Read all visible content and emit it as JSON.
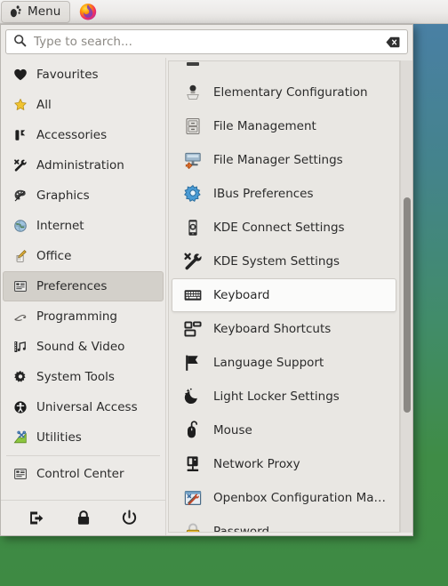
{
  "taskbar": {
    "menu_button_label": "Menu",
    "menu_icon": "footprint-icon",
    "launchers": [
      {
        "name": "firefox-launcher",
        "label": "Firefox"
      }
    ]
  },
  "search": {
    "placeholder": "Type to search...",
    "value": "",
    "icon": "search-icon",
    "clear_icon": "backspace-clear-icon"
  },
  "sidebar": {
    "items": [
      {
        "label": "Favourites",
        "icon": "heart-icon",
        "selected": false
      },
      {
        "label": "All",
        "icon": "star-icon",
        "selected": false
      },
      {
        "label": "Accessories",
        "icon": "accessories-icon",
        "selected": false
      },
      {
        "label": "Administration",
        "icon": "tools-icon",
        "selected": false
      },
      {
        "label": "Graphics",
        "icon": "palette-icon",
        "selected": false
      },
      {
        "label": "Internet",
        "icon": "globe-icon",
        "selected": false
      },
      {
        "label": "Office",
        "icon": "office-icon",
        "selected": false
      },
      {
        "label": "Preferences",
        "icon": "preferences-icon",
        "selected": true
      },
      {
        "label": "Programming",
        "icon": "programming-icon",
        "selected": false
      },
      {
        "label": "Sound & Video",
        "icon": "multimedia-icon",
        "selected": false
      },
      {
        "label": "System Tools",
        "icon": "gear-icon",
        "selected": false
      },
      {
        "label": "Universal Access",
        "icon": "accessibility-icon",
        "selected": false
      },
      {
        "label": "Utilities",
        "icon": "utilities-icon",
        "selected": false
      }
    ],
    "footer_items": [
      {
        "label": "Control Center",
        "icon": "preferences-icon"
      }
    ],
    "session_buttons": [
      {
        "name": "log-out-button",
        "icon": "logout-icon",
        "label": "Log Out"
      },
      {
        "name": "lock-button",
        "icon": "lock-icon",
        "label": "Lock Screen"
      },
      {
        "name": "shutdown-button",
        "icon": "power-icon",
        "label": "Shut Down"
      }
    ]
  },
  "applist": {
    "category": "Preferences",
    "scroll": {
      "thumb_top_pct": 28,
      "thumb_height_pct": 44
    },
    "items": [
      {
        "label": "",
        "icon": "cut-off-icon",
        "hovered": false,
        "partial": true
      },
      {
        "label": "Elementary Configuration",
        "icon": "elementary-config-icon",
        "hovered": false
      },
      {
        "label": "File Management",
        "icon": "file-cabinet-icon",
        "hovered": false
      },
      {
        "label": "File Manager Settings",
        "icon": "file-manager-prefs-icon",
        "hovered": false
      },
      {
        "label": "IBus Preferences",
        "icon": "ibus-gear-icon",
        "hovered": false
      },
      {
        "label": "KDE Connect Settings",
        "icon": "phone-kde-icon",
        "hovered": false
      },
      {
        "label": "KDE System Settings",
        "icon": "tools-icon",
        "hovered": false
      },
      {
        "label": "Keyboard",
        "icon": "keyboard-icon",
        "hovered": true
      },
      {
        "label": "Keyboard Shortcuts",
        "icon": "shortcuts-icon",
        "hovered": false
      },
      {
        "label": "Language Support",
        "icon": "flag-icon",
        "hovered": false
      },
      {
        "label": "Light Locker Settings",
        "icon": "moon-stars-icon",
        "hovered": false
      },
      {
        "label": "Mouse",
        "icon": "mouse-icon",
        "hovered": false
      },
      {
        "label": "Network Proxy",
        "icon": "network-proxy-icon",
        "hovered": false
      },
      {
        "label": "Openbox Configuration Ma…",
        "icon": "openbox-config-icon",
        "hovered": false
      },
      {
        "label": "Password",
        "icon": "padlock-key-icon",
        "hovered": false
      }
    ]
  },
  "colors": {
    "window_bg": "#eceae7",
    "list_bg": "#e9e7e3",
    "selection_bg": "#d3d0ca",
    "hover_bg": "#fbfbfa",
    "text": "#2b2b2b",
    "desktop_top": "#4a7fa8",
    "desktop_bottom": "#3e8a43"
  }
}
